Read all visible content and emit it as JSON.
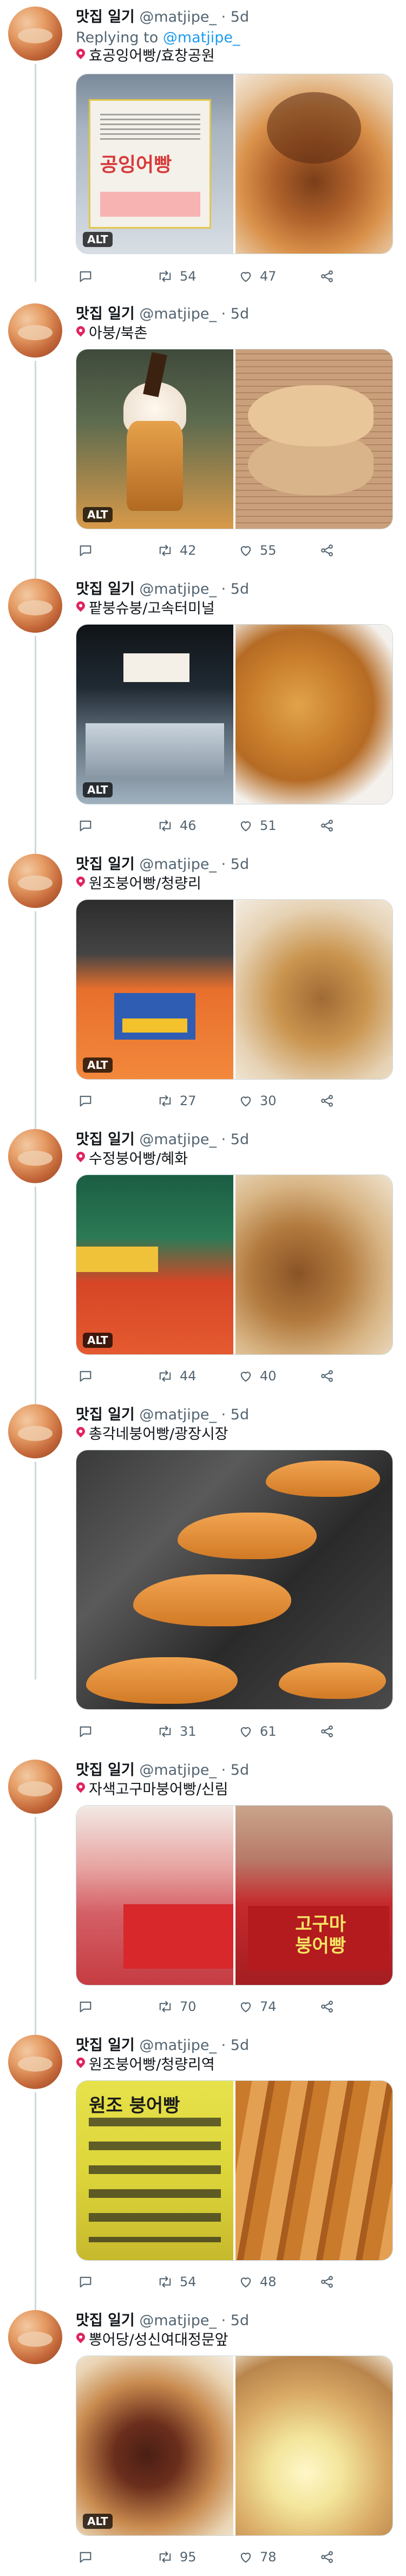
{
  "tweets": [
    {
      "name": "맛집 일기",
      "handle": "@matjipe_",
      "time": "· 5d",
      "replying_prefix": "Replying to",
      "replying_handle": "@matjipe_",
      "location": "효공잉어빵/효창공원",
      "sign_text": "공잉어빵",
      "alt": "ALT",
      "retweets": "54",
      "likes": "47"
    },
    {
      "name": "맛집 일기",
      "handle": "@matjipe_",
      "time": "· 5d",
      "location": "아붕/북촌",
      "alt": "ALT",
      "retweets": "42",
      "likes": "55"
    },
    {
      "name": "맛집 일기",
      "handle": "@matjipe_",
      "time": "· 5d",
      "location": "팥붕슈붕/고속터미널",
      "alt": "ALT",
      "retweets": "46",
      "likes": "51"
    },
    {
      "name": "맛집 일기",
      "handle": "@matjipe_",
      "time": "· 5d",
      "location": "원조붕어빵/청량리",
      "alt": "ALT",
      "retweets": "27",
      "likes": "30"
    },
    {
      "name": "맛집 일기",
      "handle": "@matjipe_",
      "time": "· 5d",
      "location": "수정붕어빵/혜화",
      "alt": "ALT",
      "retweets": "44",
      "likes": "40"
    },
    {
      "name": "맛집 일기",
      "handle": "@matjipe_",
      "time": "· 5d",
      "location": "총각네붕어빵/광장시장",
      "retweets": "31",
      "likes": "61"
    },
    {
      "name": "맛집 일기",
      "handle": "@matjipe_",
      "time": "· 5d",
      "location": "자색고구마붕어빵/신림",
      "sign_text": "고구마\n붕어빵",
      "retweets": "70",
      "likes": "74"
    },
    {
      "name": "맛집 일기",
      "handle": "@matjipe_",
      "time": "· 5d",
      "location": "원조붕어빵/청량리역",
      "sign_text": "원조 붕어빵",
      "retweets": "54",
      "likes": "48"
    },
    {
      "name": "맛집 일기",
      "handle": "@matjipe_",
      "time": "· 5d",
      "location": "뽕어당/성신여대정문앞",
      "alt": "ALT",
      "retweets": "95",
      "likes": "78"
    }
  ],
  "icons": {
    "reply": "reply-icon",
    "retweet": "retweet-icon",
    "like": "heart-icon",
    "share": "share-icon",
    "location": "pin-icon"
  },
  "colors": {
    "link": "#1d9bf0",
    "muted": "#536471",
    "thread_line": "#cfd9de"
  }
}
